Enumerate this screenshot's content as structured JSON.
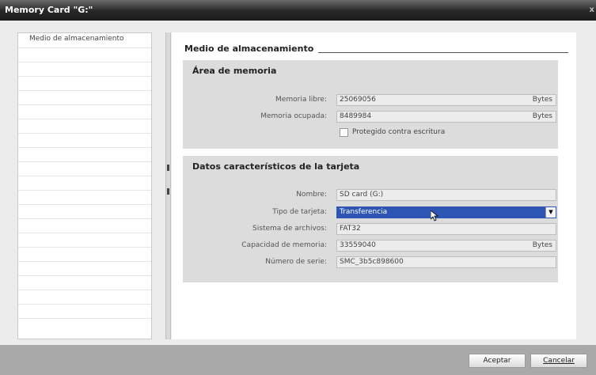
{
  "window": {
    "title": "Memory Card \"G:\"",
    "close_label": "x"
  },
  "nav": {
    "items": [
      {
        "label": "Medio de almacenamiento"
      }
    ]
  },
  "content": {
    "heading": "Medio de almacenamiento",
    "memory_area": {
      "title": "Área de memoria",
      "free_label": "Memoria libre:",
      "free_value": "25069056",
      "free_unit": "Bytes",
      "used_label": "Memoria ocupada:",
      "used_value": "8489984",
      "used_unit": "Bytes",
      "write_protect_label": "Protegido contra escritura",
      "write_protect_checked": false
    },
    "card_data": {
      "title": "Datos característicos de la tarjeta",
      "name_label": "Nombre:",
      "name_value": "SD card (G:)",
      "type_label": "Tipo de tarjeta:",
      "type_value": "Transferencia",
      "fs_label": "Sistema de archivos:",
      "fs_value": "FAT32",
      "capacity_label": "Capacidad de memoria:",
      "capacity_value": "33559040",
      "capacity_unit": "Bytes",
      "serial_label": "Número de serie:",
      "serial_value": "SMC_3b5c898600"
    }
  },
  "footer": {
    "accept_label": "Aceptar",
    "cancel_label": "Cancelar"
  },
  "colors": {
    "title_bg": "#262626",
    "selection": "#2e55b3",
    "section_bg": "#dcdcdc"
  },
  "icons": {
    "dropdown": "chevron-down-icon",
    "cursor": "mouse-pointer-icon"
  }
}
